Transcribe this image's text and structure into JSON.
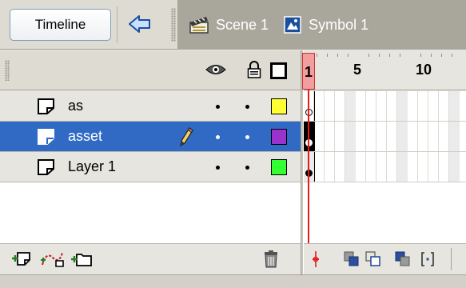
{
  "toolbar": {
    "timeline_label": "Timeline",
    "back_icon": "arrow-left-icon"
  },
  "breadcrumbs": [
    {
      "label": "Scene 1",
      "icon": "clapperboard-icon"
    },
    {
      "label": "Symbol 1",
      "icon": "symbol-icon"
    }
  ],
  "header_icons": [
    "eye-icon",
    "lock-icon",
    "outline-square-icon"
  ],
  "layers": [
    {
      "name": "as",
      "outline_color": "#ffff33",
      "selected": false
    },
    {
      "name": "asset",
      "outline_color": "#9933cc",
      "selected": true,
      "editing_icon": "pencil-icon"
    },
    {
      "name": "Layer 1",
      "outline_color": "#33ff33",
      "selected": false
    }
  ],
  "ruler": {
    "labels": [
      "1",
      "5",
      "10"
    ]
  },
  "layer_toolbar_icons": [
    "insert-layer-icon",
    "add-motion-guide-icon",
    "insert-folder-icon",
    "trash-icon"
  ],
  "frame_toolbar_icons": [
    "center-frame-icon",
    "onion-skin-icon",
    "onion-skin-outlines-icon",
    "edit-multiple-frames-icon",
    "modify-onion-markers-icon"
  ],
  "colors": {
    "selection": "#316ac5",
    "playhead": "#e21d1d",
    "breadcrumb_bar": "#a9a79c"
  }
}
